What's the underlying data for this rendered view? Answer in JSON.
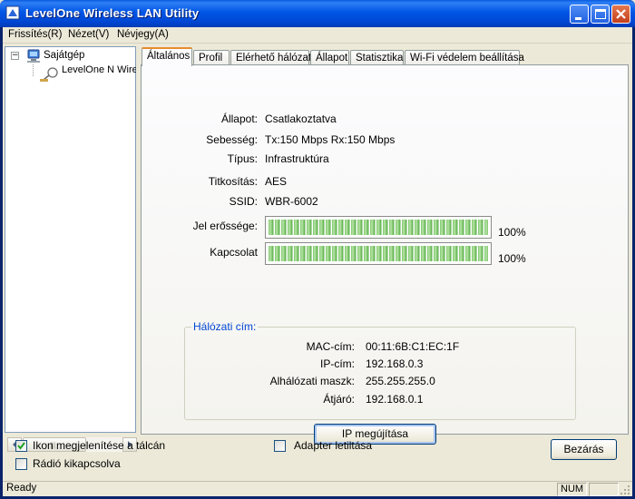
{
  "window": {
    "title": "LevelOne Wireless LAN Utility",
    "colors": {
      "titlebar": "#0055e5",
      "close_button": "#c3401b",
      "tab_highlight": "#e68b2c",
      "group_title": "#0046d5"
    }
  },
  "menu": [
    {
      "label": "Frissítés(R)"
    },
    {
      "label": "Nézet(V)"
    },
    {
      "label": "Névjegy(A)"
    }
  ],
  "tree": {
    "root": "Sajátgép",
    "expander": "−",
    "child": "LevelOne N Wireless"
  },
  "tabs": [
    {
      "label": "Általános",
      "active": true
    },
    {
      "label": "Profil"
    },
    {
      "label": "Elérhető hálózat"
    },
    {
      "label": "Állapot"
    },
    {
      "label": "Statisztika"
    },
    {
      "label": "Wi-Fi védelem beállítása"
    }
  ],
  "general": {
    "status": {
      "label": "Állapot:",
      "value": "Csatlakoztatva"
    },
    "speed": {
      "label": "Sebesség:",
      "value": "Tx:150 Mbps Rx:150 Mbps"
    },
    "type": {
      "label": "Típus:",
      "value": "Infrastruktúra"
    },
    "encryption": {
      "label": "Titkosítás:",
      "value": "AES"
    },
    "ssid": {
      "label": "SSID:",
      "value": "WBR-6002"
    },
    "signal": {
      "label": "Jel erőssége:",
      "percent_text": "100%",
      "level": 1.0
    },
    "link": {
      "label": "Kapcsolat",
      "percent_text": "100%",
      "level": 1.0
    }
  },
  "network": {
    "title": "Hálózati cím:",
    "mac": {
      "label": "MAC-cím:",
      "value": "00:11:6B:C1:EC:1F"
    },
    "ip": {
      "label": "IP-cím:",
      "value": "192.168.0.3"
    },
    "mask": {
      "label": "Alhálózati maszk:",
      "value": "255.255.255.0"
    },
    "gateway": {
      "label": "Átjáró:",
      "value": "192.168.0.1"
    },
    "renew_button": "IP megújítása"
  },
  "options": {
    "tray_icon": {
      "label": "Ikon megjelenítése a tálcán",
      "checked": true
    },
    "radio_off": {
      "label": "Rádió kikapcsolva",
      "checked": false
    },
    "disable_adapter": {
      "label": "Adapter letiltása",
      "checked": false
    }
  },
  "close_button": "Bezárás",
  "statusbar": {
    "text": "Ready",
    "num": "NUM"
  }
}
